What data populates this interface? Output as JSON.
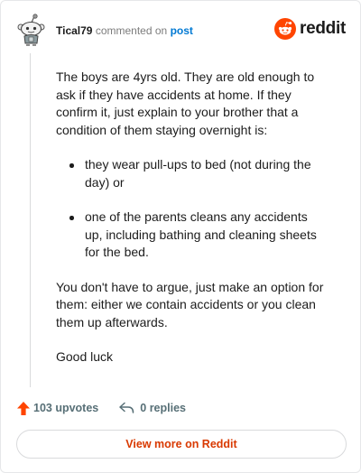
{
  "header": {
    "username": "Tical79",
    "verb": "commented on",
    "post_link": "post",
    "brand": "reddit"
  },
  "comment": {
    "intro": "The boys are 4yrs old. They are old enough to ask if they have accidents at home. If they confirm it, just explain to your brother that a condition of them staying overnight is:",
    "bullets": [
      "they wear pull-ups to bed (not during the day) or",
      "one of the parents cleans any accidents up, including bathing and cleaning sheets for the bed."
    ],
    "paragraph2": "You don't have to argue, just make an option for them: either we contain accidents or you clean them up afterwards.",
    "closing": "Good luck"
  },
  "actions": {
    "upvotes": "103 upvotes",
    "replies": "0 replies"
  },
  "footer": {
    "view_more": "View more on Reddit"
  },
  "colors": {
    "upvote": "#ff4500",
    "link": "#0079d3",
    "view_more": "#d93900"
  }
}
